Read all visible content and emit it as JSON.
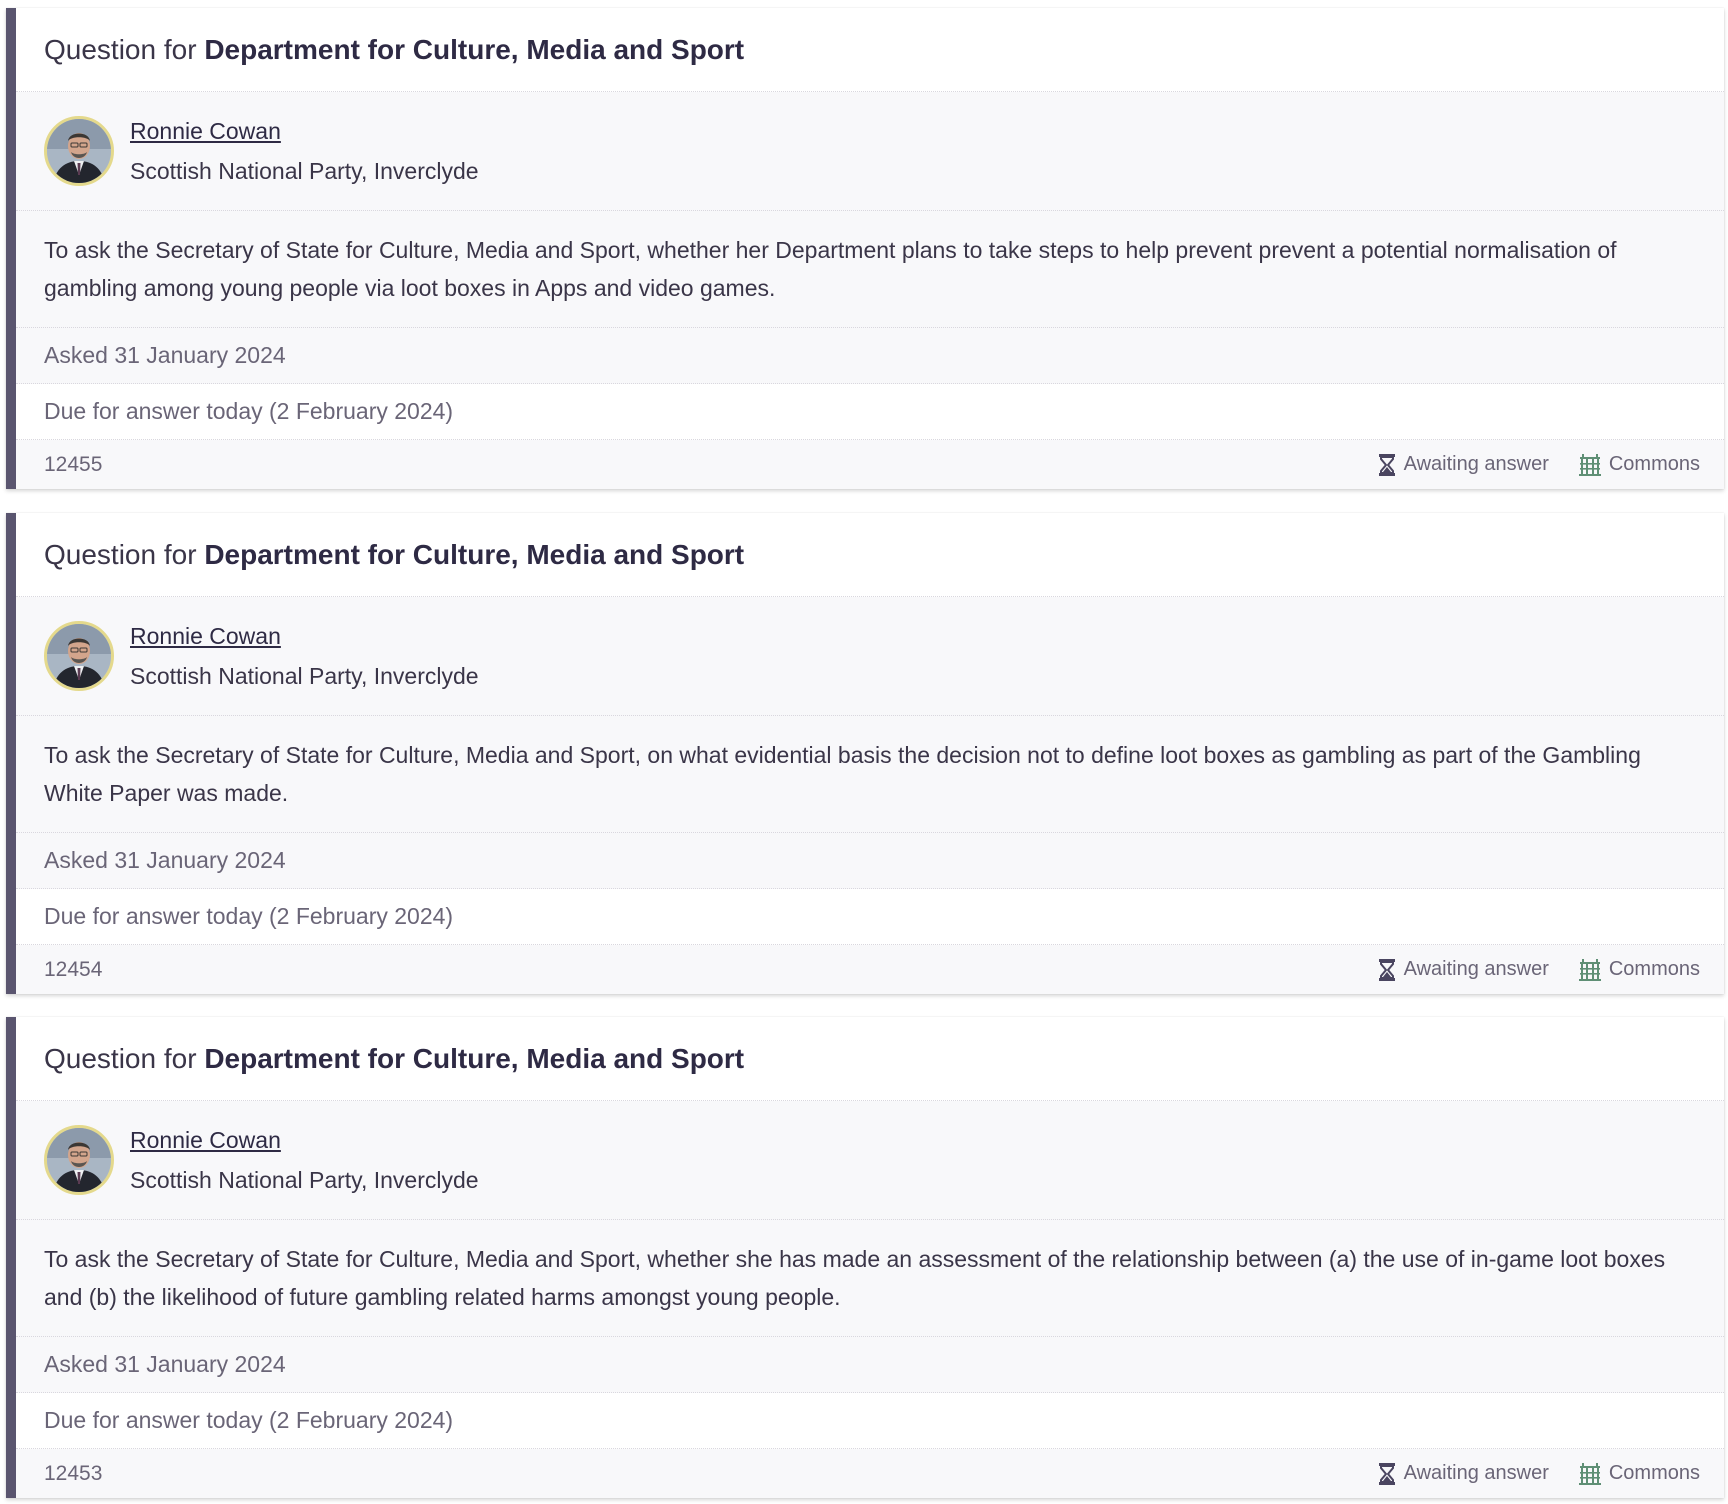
{
  "questions": [
    {
      "heading_prefix": "Question for",
      "department": "Department for Culture, Media and Sport",
      "member_name": "Ronnie Cowan",
      "member_party": "Scottish National Party, Inverclyde",
      "text": "To ask the Secretary of State for Culture, Media and Sport, whether her Department plans to take steps to help prevent prevent a potential normalisation of gambling among young people via loot boxes in Apps and video games.",
      "asked": "Asked 31 January 2024",
      "due": "Due for answer today (2 February 2024)",
      "uin": "12455",
      "status": "Awaiting answer",
      "house": "Commons"
    },
    {
      "heading_prefix": "Question for",
      "department": "Department for Culture, Media and Sport",
      "member_name": "Ronnie Cowan",
      "member_party": "Scottish National Party, Inverclyde",
      "text": "To ask the Secretary of State for Culture, Media and Sport, on what evidential basis the decision not to define loot boxes as gambling as part of the Gambling White Paper was made.",
      "asked": "Asked 31 January 2024",
      "due": "Due for answer today (2 February 2024)",
      "uin": "12454",
      "status": "Awaiting answer",
      "house": "Commons"
    },
    {
      "heading_prefix": "Question for",
      "department": "Department for Culture, Media and Sport",
      "member_name": "Ronnie Cowan",
      "member_party": "Scottish National Party, Inverclyde",
      "text": "To ask the Secretary of State for Culture, Media and Sport, whether she has made an assessment of the relationship between (a) the use of in-game loot boxes and (b) the likelihood of future gambling related harms amongst young people.",
      "asked": "Asked 31 January 2024",
      "due": "Due for answer today (2 February 2024)",
      "uin": "12453",
      "status": "Awaiting answer",
      "house": "Commons"
    }
  ],
  "icons": {
    "status": "hourglass-icon",
    "house": "portcullis-icon"
  },
  "colors": {
    "accent_bar": "#5a556f",
    "department": "#2e2a44",
    "commons_green": "#5f8f75",
    "avatar_ring": "#e4d98c"
  }
}
